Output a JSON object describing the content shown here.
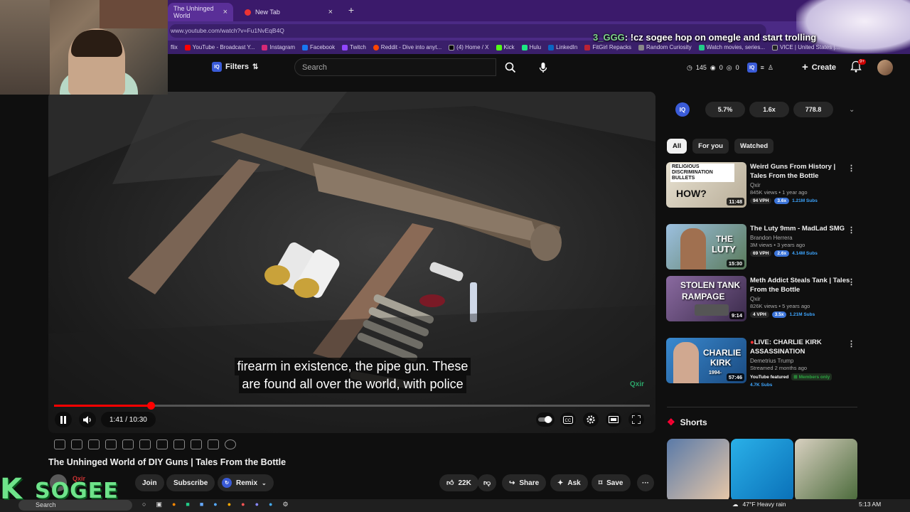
{
  "browser": {
    "tabs": [
      {
        "label": "The Unhinged World"
      },
      {
        "label": "New Tab"
      }
    ],
    "url": "www.youtube.com/watch?v=Fu1NvEqB4Q",
    "bookmarks": [
      "YouTube - Broadcast Y...",
      "Instagram",
      "Facebook",
      "Twitch",
      "Reddit - Dive into anyt...",
      "(4) Home / X",
      "Kick",
      "Hulu",
      "LinkedIn",
      "FitGirl Repacks",
      "Random Curiosity",
      "Watch movies, series...",
      "VICE | United States |..."
    ],
    "bookmark_prefix": "flix"
  },
  "overlay": {
    "user": "3_GGG",
    "message": ": !cz sogee hop on omegle and start trolling"
  },
  "header": {
    "filters_label": "Filters",
    "search_placeholder": "Search",
    "stat_views": "145",
    "stat_zero": "0",
    "stat_zero2": "0",
    "create_label": "Create",
    "notif_count": "9+"
  },
  "player": {
    "captions": [
      "firearm in existence, the pipe gun. These",
      "are found all over the world, with police"
    ],
    "time": "1:41 / 10:30",
    "progress_fraction": 0.163,
    "watermark": "Qxir"
  },
  "video": {
    "title": "The Unhinged World of DIY Guns | Tales From the Bottle",
    "channel": "Qxir",
    "join": "Join",
    "subscribe": "Subscribe",
    "remix": "Remix",
    "likes": "22K",
    "share": "Share",
    "ask": "Ask",
    "save": "Save"
  },
  "iq_panel": {
    "badge": "IQ",
    "values": [
      "5.7%",
      "1.6x",
      "778.8"
    ]
  },
  "chips": [
    "All",
    "For you",
    "Watched"
  ],
  "recommendations": [
    {
      "title": "Weird Guns From History | Tales From the Bottle",
      "channel": "Qxir",
      "meta": "845K views • 1 year ago",
      "vph": "94 VPH",
      "mult": "3.6x",
      "subs": "1.21M Subs",
      "duration": "11:48",
      "thumb_text_top": "RELIGIOUS DISCRIMINATION BULLETS",
      "thumb_text_bottom": "HOW?",
      "thumb_color": "#d9d2c0"
    },
    {
      "title": "The Luty 9mm - MadLad SMG",
      "channel": "Brandon Herrera",
      "meta": "3M views • 3 years ago",
      "vph": "69 VPH",
      "mult": "2.6x",
      "subs": "4.14M Subs",
      "duration": "15:30",
      "thumb_text_top": "THE",
      "thumb_text_bottom": "LUTY",
      "thumb_color": "#7a9ab8"
    },
    {
      "title": "Meth Addict Steals Tank | Tales From the Bottle",
      "channel": "Qxir",
      "meta": "826K views • 5 years ago",
      "vph": "4 VPH",
      "mult": "3.5x",
      "subs": "1.21M Subs",
      "duration": "9:14",
      "thumb_text_top": "STOLEN TANK",
      "thumb_text_bottom": "RAMPAGE",
      "thumb_color": "#6a4a7a"
    },
    {
      "title": "LIVE: CHARLIE KIRK ASSASSINATION",
      "channel": "Demetrius Trump",
      "meta": "Streamed 2 months ago",
      "vph": "",
      "mult": "",
      "subs": "4.7K Subs",
      "duration": "57:46",
      "thumb_text_top": "CHARLIE",
      "thumb_text_bottom": "KIRK",
      "thumb_color": "#2a6aa8",
      "featured": "YouTube featured",
      "members": "Members only",
      "years": "1994-"
    }
  ],
  "shorts_label": "Shorts",
  "taskbar": {
    "search": "Search",
    "weather": "47°F  Heavy rain",
    "clock": "5:13 AM"
  },
  "streamer_logo": {
    "k": "K",
    "word": "SOGEE"
  },
  "colors": {
    "accent_red": "#ff0000",
    "iq_blue": "#3a5bd8",
    "purple_chrome": "#3b1a6b",
    "logo_green": "#6ee38a"
  }
}
